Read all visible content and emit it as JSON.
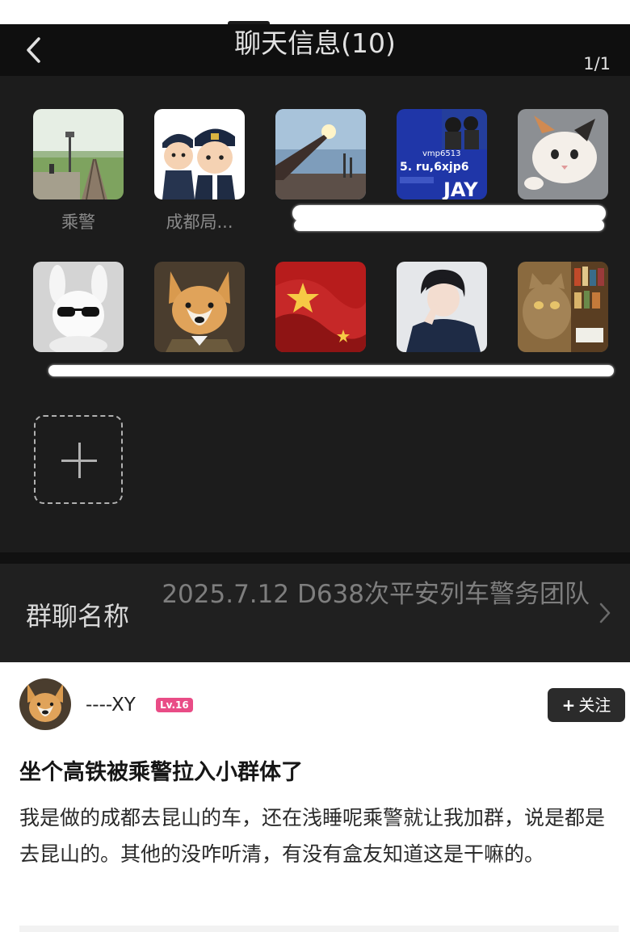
{
  "header": {
    "title": "聊天信息(10)",
    "page_indicator": "1/1"
  },
  "members": [
    {
      "name": "乘警",
      "avatar": "railway-platform-photo"
    },
    {
      "name": "成都局...",
      "avatar": "cartoon-police-officers"
    },
    {
      "name": "",
      "avatar": "hand-sky-photo"
    },
    {
      "name": "",
      "avatar": "jay-album-cover"
    },
    {
      "name": "",
      "avatar": "kitten-photo"
    },
    {
      "name": "",
      "avatar": "white-bunny-sunglasses"
    },
    {
      "name": "",
      "avatar": "corgi-illustration"
    },
    {
      "name": "",
      "avatar": "red-flag-photo"
    },
    {
      "name": "",
      "avatar": "anime-boy"
    },
    {
      "name": "",
      "avatar": "cat-in-library"
    }
  ],
  "jay_cover_text": {
    "line1": "vmp6513",
    "line2": "5. ru,6xjp6",
    "line3": "JAY"
  },
  "group": {
    "label": "群聊名称",
    "value": "2025.7.12 D638次平安列车警务团队"
  },
  "post": {
    "author": "----XY",
    "level": "Lv.16",
    "follow_label": "关注",
    "title": "坐个高铁被乘警拉入小群体了",
    "body": "我是做的成都去昆山的车，还在浅睡呢乘警就让我加群，说是都是去昆山的。其他的没咋听清，有没有盒友知道这是干嘛的。"
  },
  "colors": {
    "dark_bg": "#1c1c1c",
    "level_badge": "#e94c86",
    "follow_button": "#2b2b2b"
  }
}
